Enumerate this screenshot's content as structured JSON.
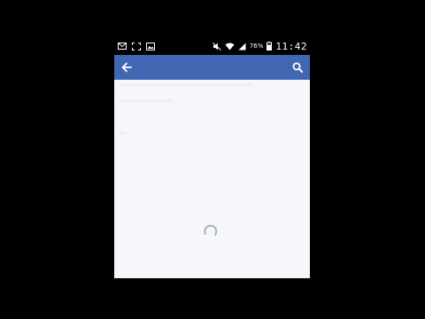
{
  "status_bar": {
    "battery_percent": "76%",
    "time": "11:42",
    "icons": [
      "mail-icon",
      "screenshot-icon",
      "image-icon",
      "mute-icon",
      "wifi-icon",
      "signal-icon",
      "battery-icon"
    ]
  },
  "app_bar": {
    "background": "#4267b2",
    "back_icon": "arrow-left-icon",
    "search_icon": "search-icon"
  },
  "content": {
    "state": "loading",
    "background": "#f6f7fb"
  }
}
